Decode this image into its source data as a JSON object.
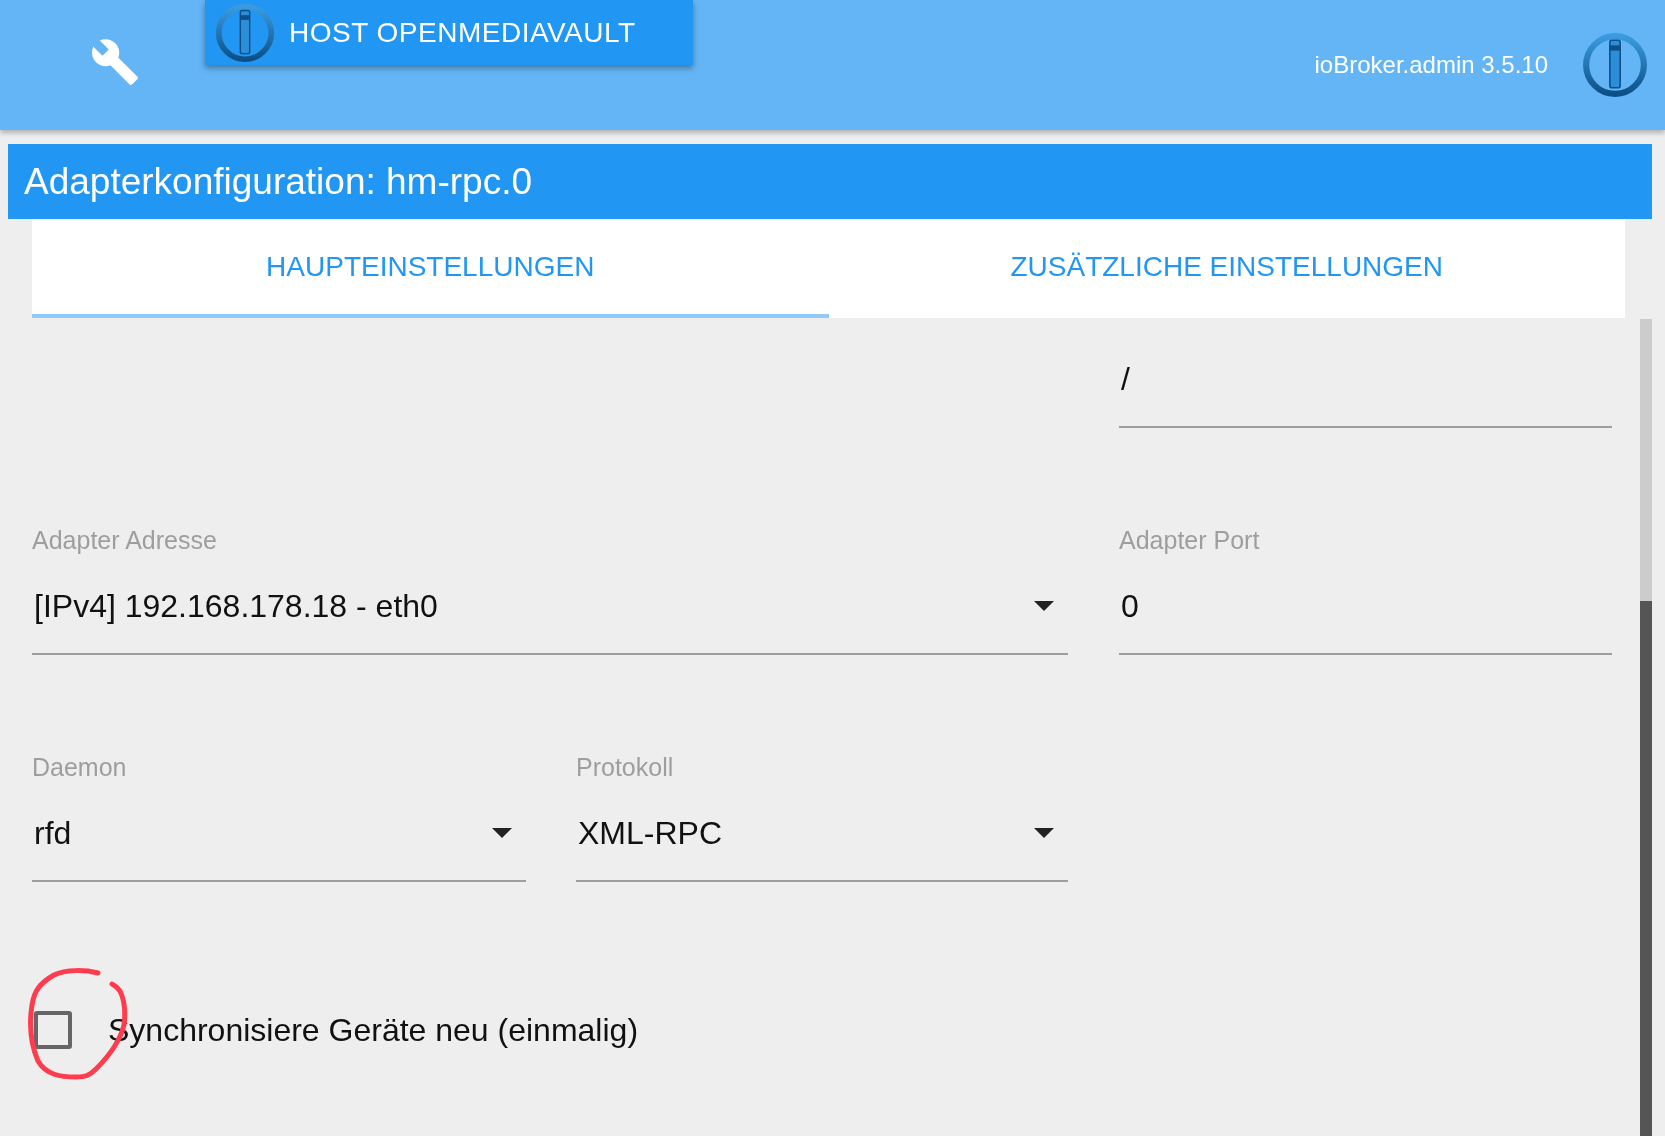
{
  "header": {
    "host_button": "HOST OPENMEDIAVAULT",
    "version": "ioBroker.admin 3.5.10"
  },
  "title": "Adapterkonfiguration: hm-rpc.0",
  "tabs": [
    {
      "label": "HAUPTEINSTELLUNGEN",
      "selected": true
    },
    {
      "label": "ZUSÄTZLICHE EINSTELLUNGEN",
      "selected": false
    }
  ],
  "fields": [
    {
      "kind": "text",
      "value": "/"
    },
    {
      "kind": "select",
      "label": "Adapter Adresse",
      "value": "[IPv4] 192.168.178.18 - eth0"
    },
    {
      "kind": "text",
      "label": "Adapter Port",
      "value": "0"
    },
    {
      "kind": "select",
      "label": "Daemon",
      "value": "rfd"
    },
    {
      "kind": "select",
      "label": "Protokoll",
      "value": "XML-RPC"
    }
  ],
  "checkbox": {
    "label": "Synchronisiere Geräte neu (einmalig)",
    "checked": false
  }
}
